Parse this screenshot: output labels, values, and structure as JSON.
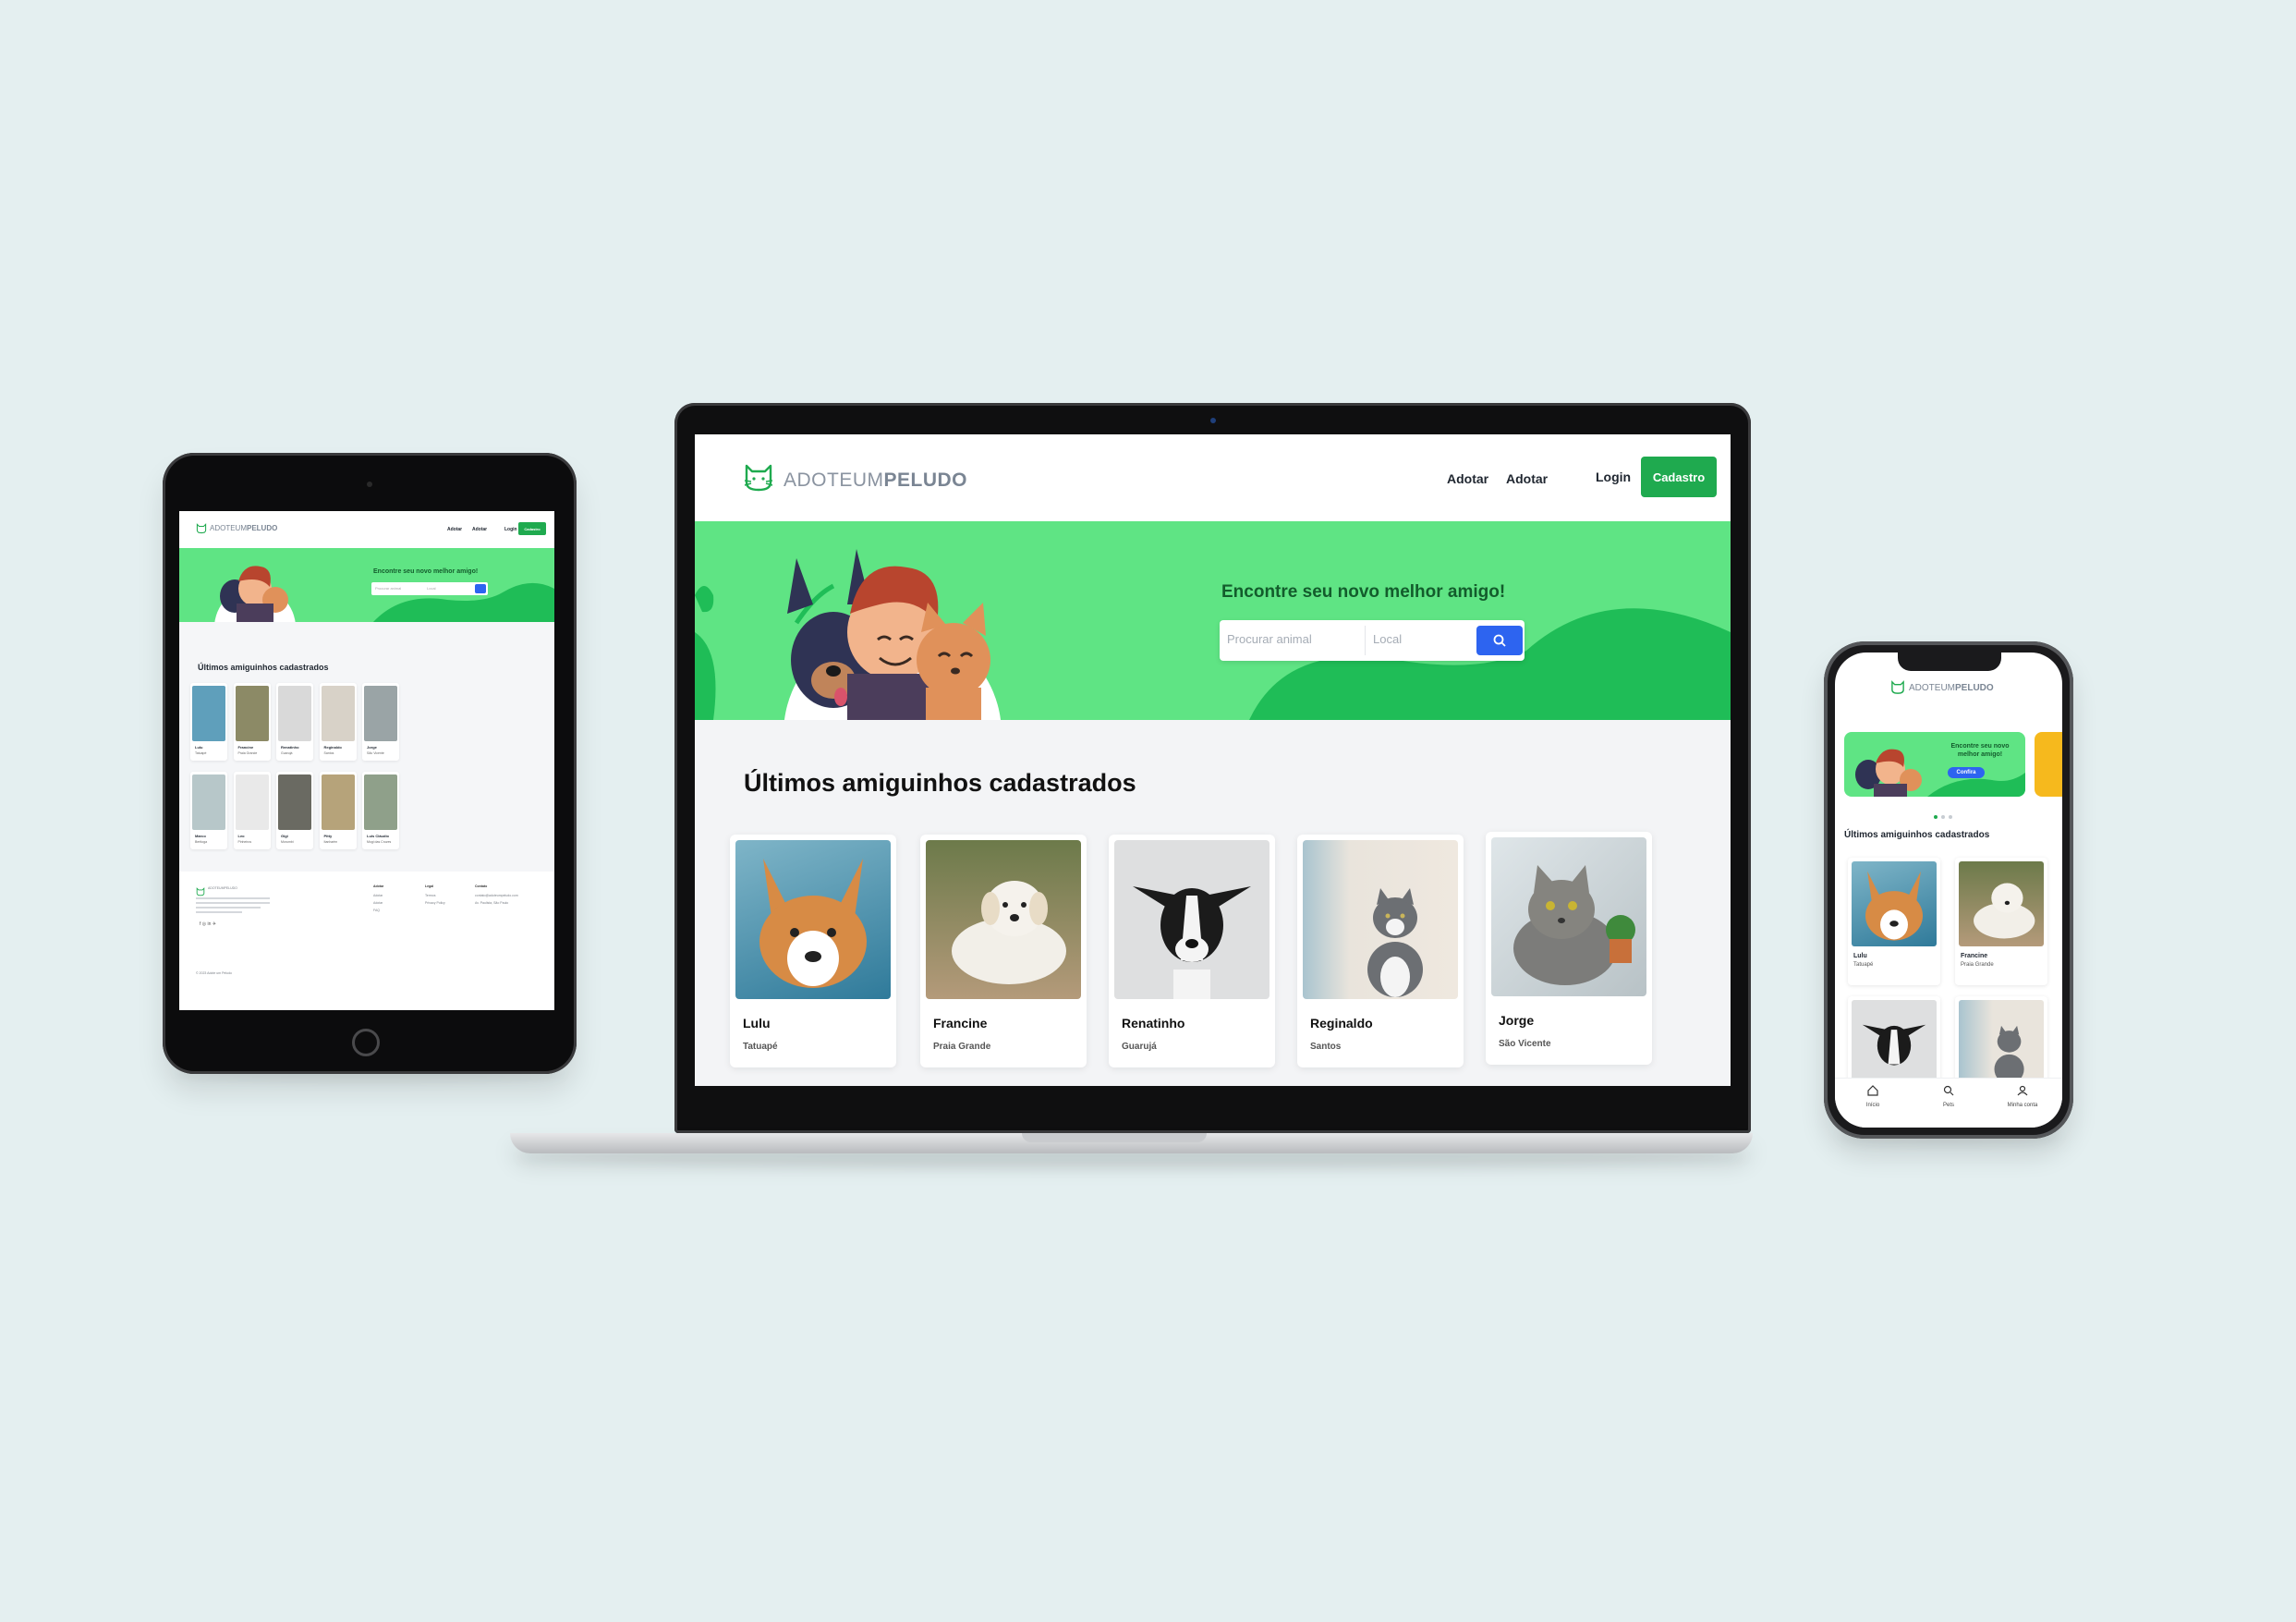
{
  "brand": {
    "logo_light": "ADOTEUM",
    "logo_bold": "PELUDO",
    "primary_green": "#5fe484",
    "button_green": "#1faa4f",
    "search_blue": "#2d64f0"
  },
  "nav": {
    "item1": "Adotar",
    "item2": "Adotar",
    "login": "Login",
    "signup": "Cadastro"
  },
  "hero": {
    "title": "Encontre seu novo melhor amigo!",
    "search_animal_placeholder": "Procurar animal",
    "search_local_placeholder": "Local"
  },
  "section_title": "Últimos amiguinhos cadastrados",
  "laptop_pets": [
    {
      "name": "Lulu",
      "location": "Tatuapé"
    },
    {
      "name": "Francine",
      "location": "Praia Grande"
    },
    {
      "name": "Renatinho",
      "location": "Guarujá"
    },
    {
      "name": "Reginaldo",
      "location": "Santos"
    },
    {
      "name": "Jorge",
      "location": "São Vicente"
    }
  ],
  "tablet_pets": [
    {
      "name": "Lulu",
      "location": "Tatuapé"
    },
    {
      "name": "Francine",
      "location": "Praia Grande"
    },
    {
      "name": "Renatinho",
      "location": "Guarujá"
    },
    {
      "name": "Reginaldo",
      "location": "Santos"
    },
    {
      "name": "Jorge",
      "location": "São Vicente"
    },
    {
      "name": "Marco",
      "location": "Bertioga"
    },
    {
      "name": "Leo",
      "location": "Pinheiros"
    },
    {
      "name": "Gigi",
      "location": "Morumbi"
    },
    {
      "name": "Pitty",
      "location": "Itanhaém"
    },
    {
      "name": "Luis Cláudio",
      "location": "Mogi das Cruzes"
    }
  ],
  "tablet_footer": {
    "col1_head": "Adotar",
    "col1_items": [
      "Adotar",
      "Adotar",
      "FAQ"
    ],
    "col2_head": "Legal",
    "col2_items": [
      "Termos",
      "Privacy Policy"
    ],
    "col3_head": "Contato",
    "col3_items": [
      "contato@adoteumpeludo.com",
      "Av. Paulista, São Paulo"
    ],
    "copyright": "© 2023 Adote um Peludo"
  },
  "phone": {
    "banner_title": "Encontre seu novo melhor amigo!",
    "banner_button": "Confira",
    "pets": [
      {
        "name": "Lulu",
        "location": "Tatuapé"
      },
      {
        "name": "Francine",
        "location": "Praia Grande"
      }
    ],
    "tabs": [
      "Início",
      "Pets",
      "Minha conta"
    ]
  }
}
